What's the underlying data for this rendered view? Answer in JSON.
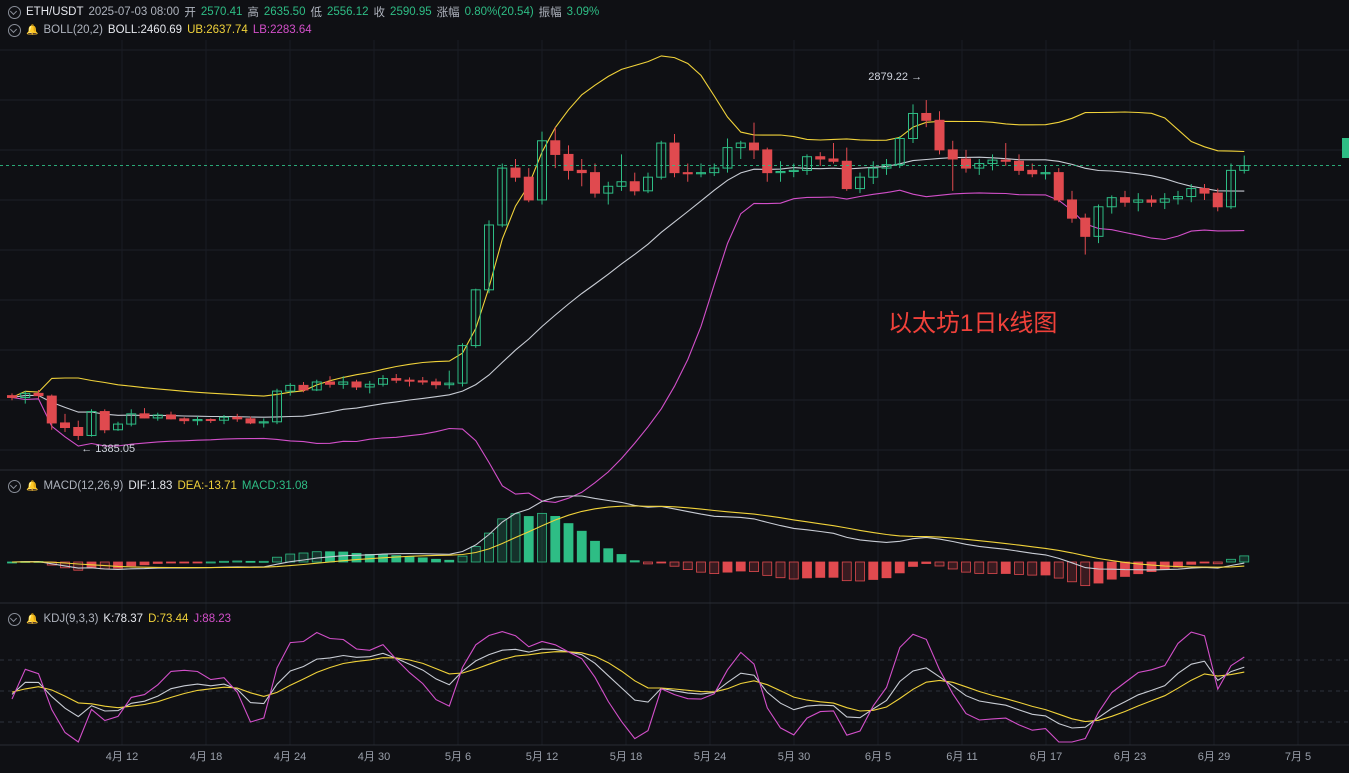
{
  "header": {
    "symbol": "ETH/USDT",
    "datetime": "2025-07-03 08:00",
    "open_label": "开",
    "open": "2570.41",
    "high_label": "高",
    "high": "2635.50",
    "low_label": "低",
    "low": "2556.12",
    "close_label": "收",
    "close": "2590.95",
    "change_label": "涨幅",
    "change": "0.80%(20.54)",
    "amp_label": "振幅",
    "amp": "3.09%"
  },
  "boll": {
    "name": "BOLL(20,2)",
    "mid": "BOLL:2460.69",
    "ub": "UB:2637.74",
    "lb": "LB:2283.64"
  },
  "macd": {
    "name": "MACD(12,26,9)",
    "dif": "DIF:1.83",
    "dea": "DEA:-13.71",
    "macd": "MACD:31.08"
  },
  "kdj": {
    "name": "KDJ(9,3,3)",
    "k": "K:78.37",
    "d": "D:73.44",
    "j": "J:88.23"
  },
  "annotation": "以太坊1日k线图",
  "chart_data": {
    "type": "candlestick",
    "xaxis_labels": [
      "4月 12",
      "4月 18",
      "4月 24",
      "4月 30",
      "5月 6",
      "5月 12",
      "5月 18",
      "5月 24",
      "5月 30",
      "6月 5",
      "6月 11",
      "6月 17",
      "6月 23",
      "6月 29",
      "7月 5"
    ],
    "high_marker": "2879.22",
    "low_marker": "1385.05",
    "colors": {
      "up": "#2ebd85",
      "down": "#e04a4f",
      "boll_mid": "#c8ccd4",
      "boll_ub": "#f0d23a",
      "boll_lb": "#d24fc9",
      "bg": "#0f1014"
    },
    "ohlc": [
      [
        1580,
        1590,
        1560,
        1572
      ],
      [
        1572,
        1600,
        1545,
        1590
      ],
      [
        1590,
        1605,
        1568,
        1580
      ],
      [
        1578,
        1585,
        1430,
        1460
      ],
      [
        1460,
        1500,
        1420,
        1440
      ],
      [
        1440,
        1470,
        1385,
        1405
      ],
      [
        1405,
        1520,
        1400,
        1510
      ],
      [
        1510,
        1520,
        1415,
        1430
      ],
      [
        1430,
        1465,
        1425,
        1455
      ],
      [
        1455,
        1520,
        1445,
        1500
      ],
      [
        1500,
        1525,
        1480,
        1482
      ],
      [
        1482,
        1505,
        1470,
        1495
      ],
      [
        1495,
        1510,
        1475,
        1478
      ],
      [
        1478,
        1485,
        1455,
        1470
      ],
      [
        1470,
        1490,
        1450,
        1475
      ],
      [
        1475,
        1480,
        1460,
        1472
      ],
      [
        1472,
        1495,
        1455,
        1485
      ],
      [
        1485,
        1500,
        1465,
        1478
      ],
      [
        1478,
        1488,
        1455,
        1460
      ],
      [
        1460,
        1480,
        1440,
        1465
      ],
      [
        1465,
        1610,
        1455,
        1600
      ],
      [
        1600,
        1635,
        1580,
        1625
      ],
      [
        1625,
        1640,
        1595,
        1605
      ],
      [
        1605,
        1650,
        1600,
        1640
      ],
      [
        1640,
        1665,
        1615,
        1630
      ],
      [
        1630,
        1665,
        1610,
        1640
      ],
      [
        1640,
        1650,
        1605,
        1618
      ],
      [
        1618,
        1645,
        1590,
        1630
      ],
      [
        1630,
        1670,
        1620,
        1655
      ],
      [
        1655,
        1675,
        1635,
        1648
      ],
      [
        1648,
        1660,
        1620,
        1645
      ],
      [
        1645,
        1662,
        1628,
        1640
      ],
      [
        1640,
        1655,
        1610,
        1628
      ],
      [
        1628,
        1690,
        1610,
        1635
      ],
      [
        1635,
        1810,
        1620,
        1800
      ],
      [
        1800,
        2050,
        1790,
        2045
      ],
      [
        2045,
        2350,
        2030,
        2330
      ],
      [
        2330,
        2600,
        2320,
        2580
      ],
      [
        2580,
        2620,
        2520,
        2540
      ],
      [
        2540,
        2580,
        2430,
        2440
      ],
      [
        2440,
        2740,
        2420,
        2700
      ],
      [
        2700,
        2760,
        2580,
        2640
      ],
      [
        2640,
        2680,
        2530,
        2570
      ],
      [
        2570,
        2620,
        2500,
        2560
      ],
      [
        2560,
        2600,
        2450,
        2470
      ],
      [
        2470,
        2520,
        2420,
        2500
      ],
      [
        2500,
        2640,
        2480,
        2520
      ],
      [
        2520,
        2560,
        2460,
        2480
      ],
      [
        2480,
        2560,
        2470,
        2540
      ],
      [
        2540,
        2700,
        2530,
        2690
      ],
      [
        2690,
        2730,
        2540,
        2560
      ],
      [
        2560,
        2600,
        2520,
        2555
      ],
      [
        2555,
        2600,
        2540,
        2560
      ],
      [
        2560,
        2600,
        2545,
        2580
      ],
      [
        2580,
        2710,
        2560,
        2670
      ],
      [
        2670,
        2700,
        2620,
        2690
      ],
      [
        2690,
        2780,
        2620,
        2660
      ],
      [
        2660,
        2670,
        2520,
        2560
      ],
      [
        2560,
        2610,
        2520,
        2565
      ],
      [
        2565,
        2600,
        2540,
        2570
      ],
      [
        2570,
        2640,
        2550,
        2630
      ],
      [
        2630,
        2650,
        2590,
        2620
      ],
      [
        2620,
        2690,
        2600,
        2610
      ],
      [
        2610,
        2670,
        2480,
        2490
      ],
      [
        2490,
        2560,
        2470,
        2540
      ],
      [
        2540,
        2610,
        2510,
        2580
      ],
      [
        2580,
        2620,
        2550,
        2595
      ],
      [
        2595,
        2720,
        2580,
        2710
      ],
      [
        2710,
        2860,
        2690,
        2820
      ],
      [
        2820,
        2879,
        2760,
        2790
      ],
      [
        2790,
        2830,
        2640,
        2660
      ],
      [
        2660,
        2700,
        2480,
        2620
      ],
      [
        2620,
        2660,
        2560,
        2580
      ],
      [
        2580,
        2620,
        2550,
        2600
      ],
      [
        2600,
        2640,
        2570,
        2615
      ],
      [
        2615,
        2690,
        2590,
        2610
      ],
      [
        2610,
        2640,
        2550,
        2570
      ],
      [
        2570,
        2600,
        2540,
        2555
      ],
      [
        2555,
        2590,
        2530,
        2560
      ],
      [
        2560,
        2580,
        2430,
        2440
      ],
      [
        2440,
        2480,
        2340,
        2360
      ],
      [
        2360,
        2380,
        2200,
        2280
      ],
      [
        2280,
        2420,
        2250,
        2410
      ],
      [
        2410,
        2460,
        2380,
        2450
      ],
      [
        2450,
        2480,
        2410,
        2430
      ],
      [
        2430,
        2470,
        2390,
        2440
      ],
      [
        2440,
        2460,
        2410,
        2430
      ],
      [
        2430,
        2470,
        2400,
        2445
      ],
      [
        2445,
        2480,
        2420,
        2455
      ],
      [
        2455,
        2510,
        2430,
        2490
      ],
      [
        2490,
        2510,
        2440,
        2470
      ],
      [
        2470,
        2490,
        2390,
        2410
      ],
      [
        2410,
        2600,
        2400,
        2570
      ],
      [
        2570,
        2635,
        2556,
        2591
      ]
    ]
  }
}
